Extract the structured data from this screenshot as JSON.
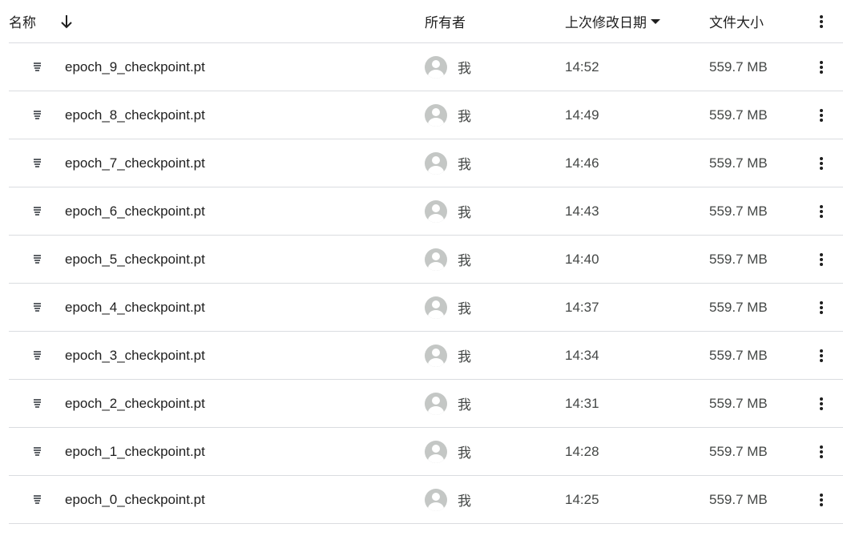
{
  "header": {
    "name_label": "名称",
    "owner_label": "所有者",
    "modified_label": "上次修改日期",
    "size_label": "文件大小"
  },
  "files": [
    {
      "name": "epoch_9_checkpoint.pt",
      "owner": "我",
      "modified": "14:52",
      "size": "559.7 MB"
    },
    {
      "name": "epoch_8_checkpoint.pt",
      "owner": "我",
      "modified": "14:49",
      "size": "559.7 MB"
    },
    {
      "name": "epoch_7_checkpoint.pt",
      "owner": "我",
      "modified": "14:46",
      "size": "559.7 MB"
    },
    {
      "name": "epoch_6_checkpoint.pt",
      "owner": "我",
      "modified": "14:43",
      "size": "559.7 MB"
    },
    {
      "name": "epoch_5_checkpoint.pt",
      "owner": "我",
      "modified": "14:40",
      "size": "559.7 MB"
    },
    {
      "name": "epoch_4_checkpoint.pt",
      "owner": "我",
      "modified": "14:37",
      "size": "559.7 MB"
    },
    {
      "name": "epoch_3_checkpoint.pt",
      "owner": "我",
      "modified": "14:34",
      "size": "559.7 MB"
    },
    {
      "name": "epoch_2_checkpoint.pt",
      "owner": "我",
      "modified": "14:31",
      "size": "559.7 MB"
    },
    {
      "name": "epoch_1_checkpoint.pt",
      "owner": "我",
      "modified": "14:28",
      "size": "559.7 MB"
    },
    {
      "name": "epoch_0_checkpoint.pt",
      "owner": "我",
      "modified": "14:25",
      "size": "559.7 MB"
    }
  ],
  "icons": {
    "sort": "arrow-down-icon",
    "sort_dropdown": "caret-down-icon",
    "more": "more-vert-icon",
    "file": "binary-file-icon",
    "avatar": "user-avatar-icon"
  },
  "colors": {
    "text_primary": "#1f1f1f",
    "text_secondary": "#444746",
    "divider": "#dadce0",
    "avatar": "#c4c7c5"
  }
}
